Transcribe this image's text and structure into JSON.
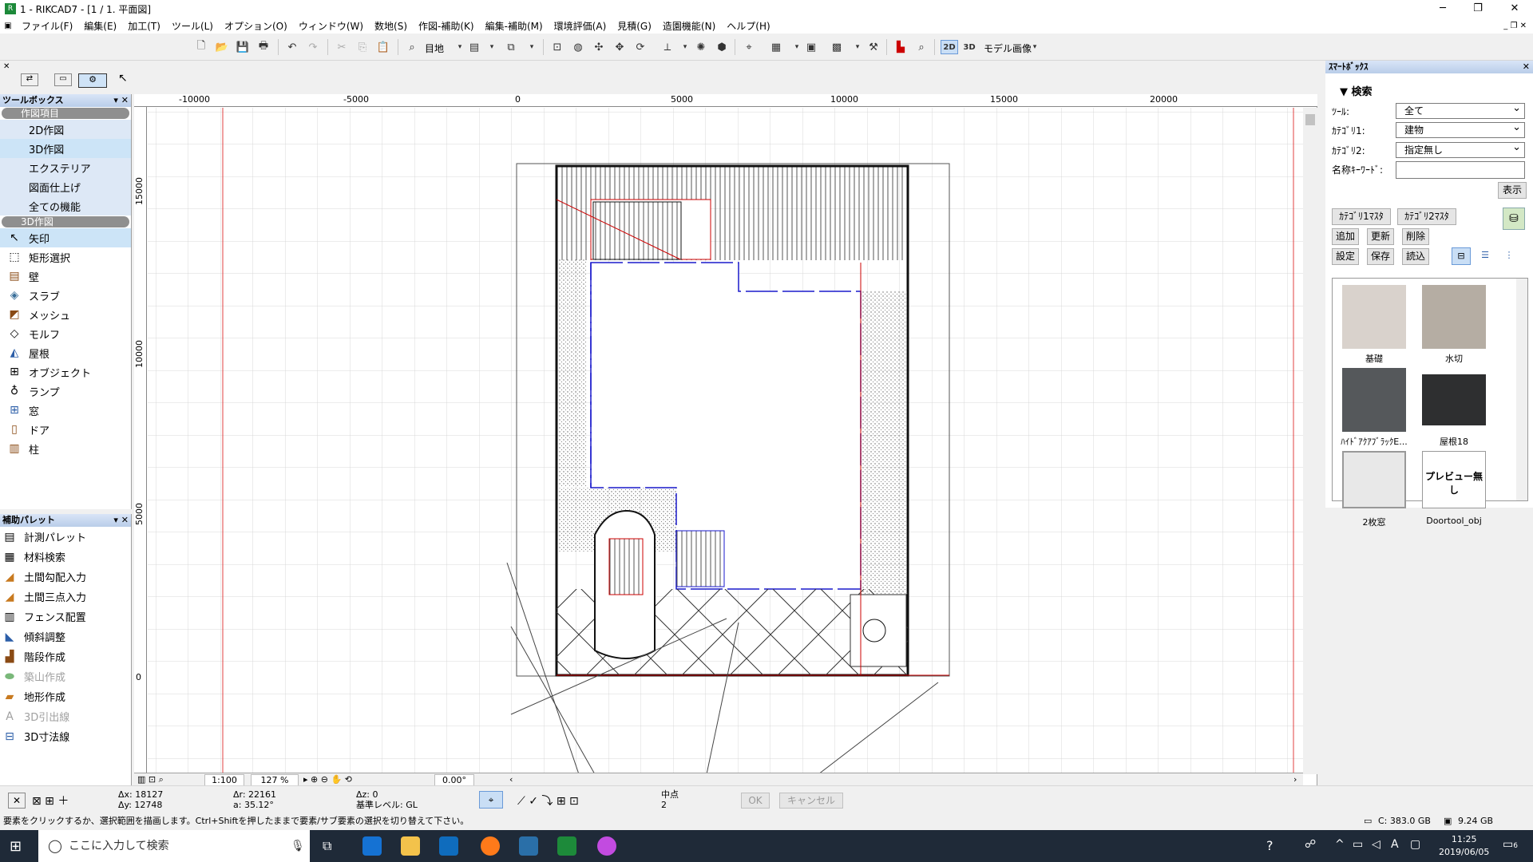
{
  "window": {
    "title": "1 - RIKCAD7 - [1 / 1. 平面図]",
    "icons": {
      "app": "rikcad-app-icon",
      "min": "minimize-icon",
      "max": "maximize-icon",
      "close": "close-icon"
    }
  },
  "menu": {
    "items": [
      "ファイル(F)",
      "編集(E)",
      "加工(T)",
      "ツール(L)",
      "オプション(O)",
      "ウィンドウ(W)",
      "数地(S)",
      "作図-補助(K)",
      "編集-補助(M)",
      "環境評価(A)",
      "見積(G)",
      "造園機能(N)",
      "ヘルプ(H)"
    ]
  },
  "toolbar": {
    "view_label": "目地",
    "mode_2d": "2D",
    "mode_3d": "3D",
    "model_label": "モデル画像"
  },
  "toolbox": {
    "title": "ツールボックス",
    "group1": "作図項目",
    "group1_items": [
      "2D作図",
      "3D作図",
      "エクステリア",
      "図面仕上げ",
      "全ての機能"
    ],
    "group2": "3D作図",
    "tools": [
      {
        "label": "矢印",
        "icon": "arrow-icon"
      },
      {
        "label": "矩形選択",
        "icon": "marquee-icon"
      },
      {
        "label": "壁",
        "icon": "wall-icon"
      },
      {
        "label": "スラブ",
        "icon": "slab-icon"
      },
      {
        "label": "メッシュ",
        "icon": "mesh-icon"
      },
      {
        "label": "モルフ",
        "icon": "morph-icon"
      },
      {
        "label": "屋根",
        "icon": "roof-icon"
      },
      {
        "label": "オブジェクト",
        "icon": "object-icon"
      },
      {
        "label": "ランプ",
        "icon": "lamp-icon"
      },
      {
        "label": "窓",
        "icon": "window-icon"
      },
      {
        "label": "ドア",
        "icon": "door-icon"
      },
      {
        "label": "柱",
        "icon": "column-icon"
      }
    ]
  },
  "assist": {
    "title": "補助パレット",
    "items": [
      {
        "label": "計測パレット",
        "enabled": true
      },
      {
        "label": "材料検索",
        "enabled": true
      },
      {
        "label": "土間勾配入力",
        "enabled": true
      },
      {
        "label": "土間三点入力",
        "enabled": true
      },
      {
        "label": "フェンス配置",
        "enabled": true
      },
      {
        "label": "傾斜調整",
        "enabled": true
      },
      {
        "label": "階段作成",
        "enabled": true
      },
      {
        "label": "築山作成",
        "enabled": false
      },
      {
        "label": "地形作成",
        "enabled": true
      },
      {
        "label": "3D引出線",
        "enabled": false
      },
      {
        "label": "3D寸法線",
        "enabled": true
      }
    ]
  },
  "ruler": {
    "h": [
      "-10000",
      "-5000",
      "0",
      "5000",
      "10000",
      "15000",
      "20000"
    ],
    "v": [
      "15000",
      "10000",
      "5000",
      "0"
    ]
  },
  "bottom": {
    "scale": "1:100",
    "zoom": "127 %",
    "angle": "0.00°"
  },
  "coords": {
    "dx": "Δx: 18127",
    "dy": "Δy: 12748",
    "dr": "Δr: 22161",
    "a": "a: 35.12°",
    "dz": "Δz: 0",
    "level": "基準レベル: GL",
    "snap": "中点",
    "snap_num": "2",
    "ok": "OK",
    "cancel": "キャンセル"
  },
  "status": {
    "message": "要素をクリックするか、選択範囲を描画します。Ctrl+Shiftを押したままで要素/サブ要素の選択を切り替えて下さい。",
    "disk": "C: 383.0 GB",
    "mem": "9.24 GB"
  },
  "smartbox": {
    "title": "ｽﾏｰﾄﾎﾞｯｸｽ",
    "search_label": "検索",
    "fields": [
      {
        "label": "ﾂｰﾙ:",
        "value": "全て"
      },
      {
        "label": "ｶﾃｺﾞﾘ1:",
        "value": "建物"
      },
      {
        "label": "ｶﾃｺﾞﾘ2:",
        "value": "指定無し"
      }
    ],
    "keyword_label": "名称ｷｰﾜｰﾄﾞ:",
    "show_btn": "表示",
    "cat1_master": "ｶﾃｺﾞﾘ1ﾏｽﾀ",
    "cat2_master": "ｶﾃｺﾞﾘ2ﾏｽﾀ",
    "buttons": [
      "追加",
      "更新",
      "削除",
      "設定",
      "保存",
      "読込"
    ],
    "thumbs": [
      {
        "label": "基礎",
        "color": "#d9d2cc"
      },
      {
        "label": "水切",
        "color": "#b5ada3"
      },
      {
        "label": "ﾊｲﾄﾞｱｸｱﾌﾞﾗｯｸE...",
        "color": "#55585b"
      },
      {
        "label": "屋根18",
        "color": "#2e2f30"
      },
      {
        "label": "2枚窓",
        "color": "#e8e8e8"
      },
      {
        "label": "Doortool_obj",
        "color": "#ffffff"
      }
    ],
    "preview_none": "プレビュー無し"
  },
  "taskbar": {
    "search_placeholder": "ここに入力して検索",
    "time": "11:25",
    "date": "2019/06/05",
    "notif": "6",
    "ime": "A"
  }
}
